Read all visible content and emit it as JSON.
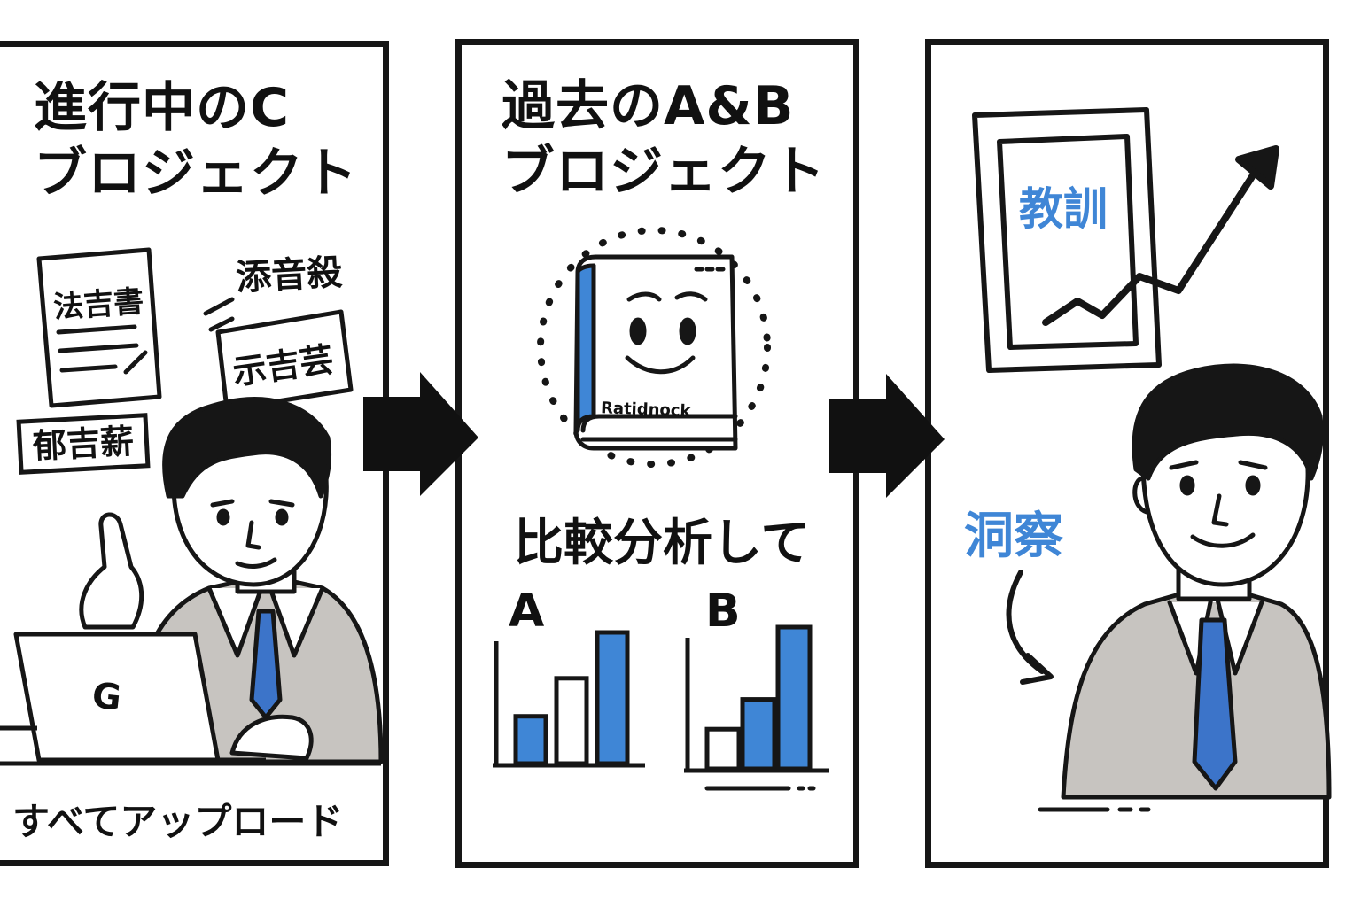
{
  "colors": {
    "accent": "#3f86d6",
    "ink": "#161616",
    "suit": "#c7c4c0",
    "tie": "#3c74c9"
  },
  "panels": [
    {
      "title_line1": "進行中のC",
      "title_line2": "ブロジェクト",
      "notes": [
        "法吉書",
        "添音殺",
        "示吉芸",
        "郁吉薪"
      ],
      "laptop_logo": "G",
      "caption": "すべてアップロード"
    },
    {
      "title_line1": "過去のA&B",
      "title_line2": "ブロジェクト",
      "book_label": "Ratidnock",
      "subtitle": "比較分析して",
      "chart_label_a": "A",
      "chart_label_b": "B"
    },
    {
      "frame_text": "教訓",
      "insight_label": "洞察"
    }
  ],
  "chart_data": [
    {
      "type": "bar",
      "title": "A",
      "values": [
        0.36,
        0.65,
        1.0
      ],
      "fill_colors": [
        "#3f86d6",
        "#ffffff",
        "#3f86d6"
      ]
    },
    {
      "type": "bar",
      "title": "B",
      "values": [
        0.28,
        0.49,
        1.0
      ],
      "fill_colors": [
        "#ffffff",
        "#3f86d6",
        "#3f86d6"
      ]
    }
  ]
}
